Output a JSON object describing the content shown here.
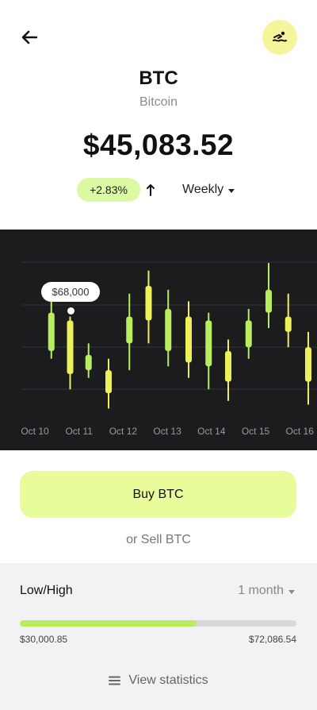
{
  "header": {
    "ticker": "BTC",
    "name": "Bitcoin",
    "price": "$45,083.52",
    "change": "+2.83%",
    "period": "Weekly"
  },
  "colors": {
    "accent": "#e8fc9c",
    "badge": "#dcf9a3",
    "chart_bg": "#1c1c1e",
    "candle_up": "#b8ee5d",
    "candle_down": "#eef05a"
  },
  "chart_data": {
    "type": "candlestick",
    "categories": [
      "Oct 10",
      "Oct 11",
      "Oct 12",
      "Oct 13",
      "Oct 14",
      "Oct 15",
      "Oct 16"
    ],
    "tooltip": "$68,000",
    "candles": [
      {
        "pos": 0.55,
        "high": 70,
        "open": 67,
        "close": 57,
        "low": 55,
        "dir": "up"
      },
      {
        "pos": 1.02,
        "high": 66,
        "open": 65,
        "close": 51,
        "low": 47,
        "dir": "down"
      },
      {
        "pos": 1.48,
        "high": 59,
        "open": 56,
        "close": 52,
        "low": 50,
        "dir": "up"
      },
      {
        "pos": 1.98,
        "high": 55,
        "open": 52,
        "close": 46,
        "low": 42,
        "dir": "down"
      },
      {
        "pos": 2.5,
        "high": 72,
        "open": 66,
        "close": 59,
        "low": 52,
        "dir": "up"
      },
      {
        "pos": 2.98,
        "high": 78,
        "open": 74,
        "close": 65,
        "low": 59,
        "dir": "down"
      },
      {
        "pos": 3.47,
        "high": 73,
        "open": 68,
        "close": 57,
        "low": 53,
        "dir": "up"
      },
      {
        "pos": 3.98,
        "high": 70,
        "open": 66,
        "close": 54,
        "low": 50,
        "dir": "down"
      },
      {
        "pos": 4.48,
        "high": 67,
        "open": 65,
        "close": 53,
        "low": 47,
        "dir": "up"
      },
      {
        "pos": 4.97,
        "high": 60,
        "open": 57,
        "close": 49,
        "low": 44,
        "dir": "down"
      },
      {
        "pos": 5.48,
        "high": 68,
        "open": 65,
        "close": 58,
        "low": 55,
        "dir": "up"
      },
      {
        "pos": 5.98,
        "high": 80,
        "open": 73,
        "close": 67,
        "low": 63,
        "dir": "up"
      },
      {
        "pos": 6.47,
        "high": 72,
        "open": 66,
        "close": 62,
        "low": 58,
        "dir": "down"
      },
      {
        "pos": 6.97,
        "high": 62,
        "open": 58,
        "close": 49,
        "low": 43,
        "dir": "down"
      },
      {
        "pos": 7.48,
        "high": 74,
        "open": 64,
        "close": 53,
        "low": 47,
        "dir": "up"
      },
      {
        "pos": 7.92,
        "high": 67,
        "open": 66,
        "close": 63,
        "low": 61,
        "dir": "down"
      }
    ],
    "ylim": [
      40,
      85
    ],
    "grid": true
  },
  "actions": {
    "buy": "Buy BTC",
    "sell": "or Sell BTC"
  },
  "stats": {
    "title": "Low/High",
    "range": "1 month",
    "low": "$30,000.85",
    "high": "$72,086.54",
    "progress": 0.64,
    "view": "View statistics"
  },
  "icons": {
    "back": "arrow-left-icon",
    "avatar": "swimmer-icon",
    "trend": "arrow-up-icon",
    "menu": "menu-lines-icon"
  }
}
